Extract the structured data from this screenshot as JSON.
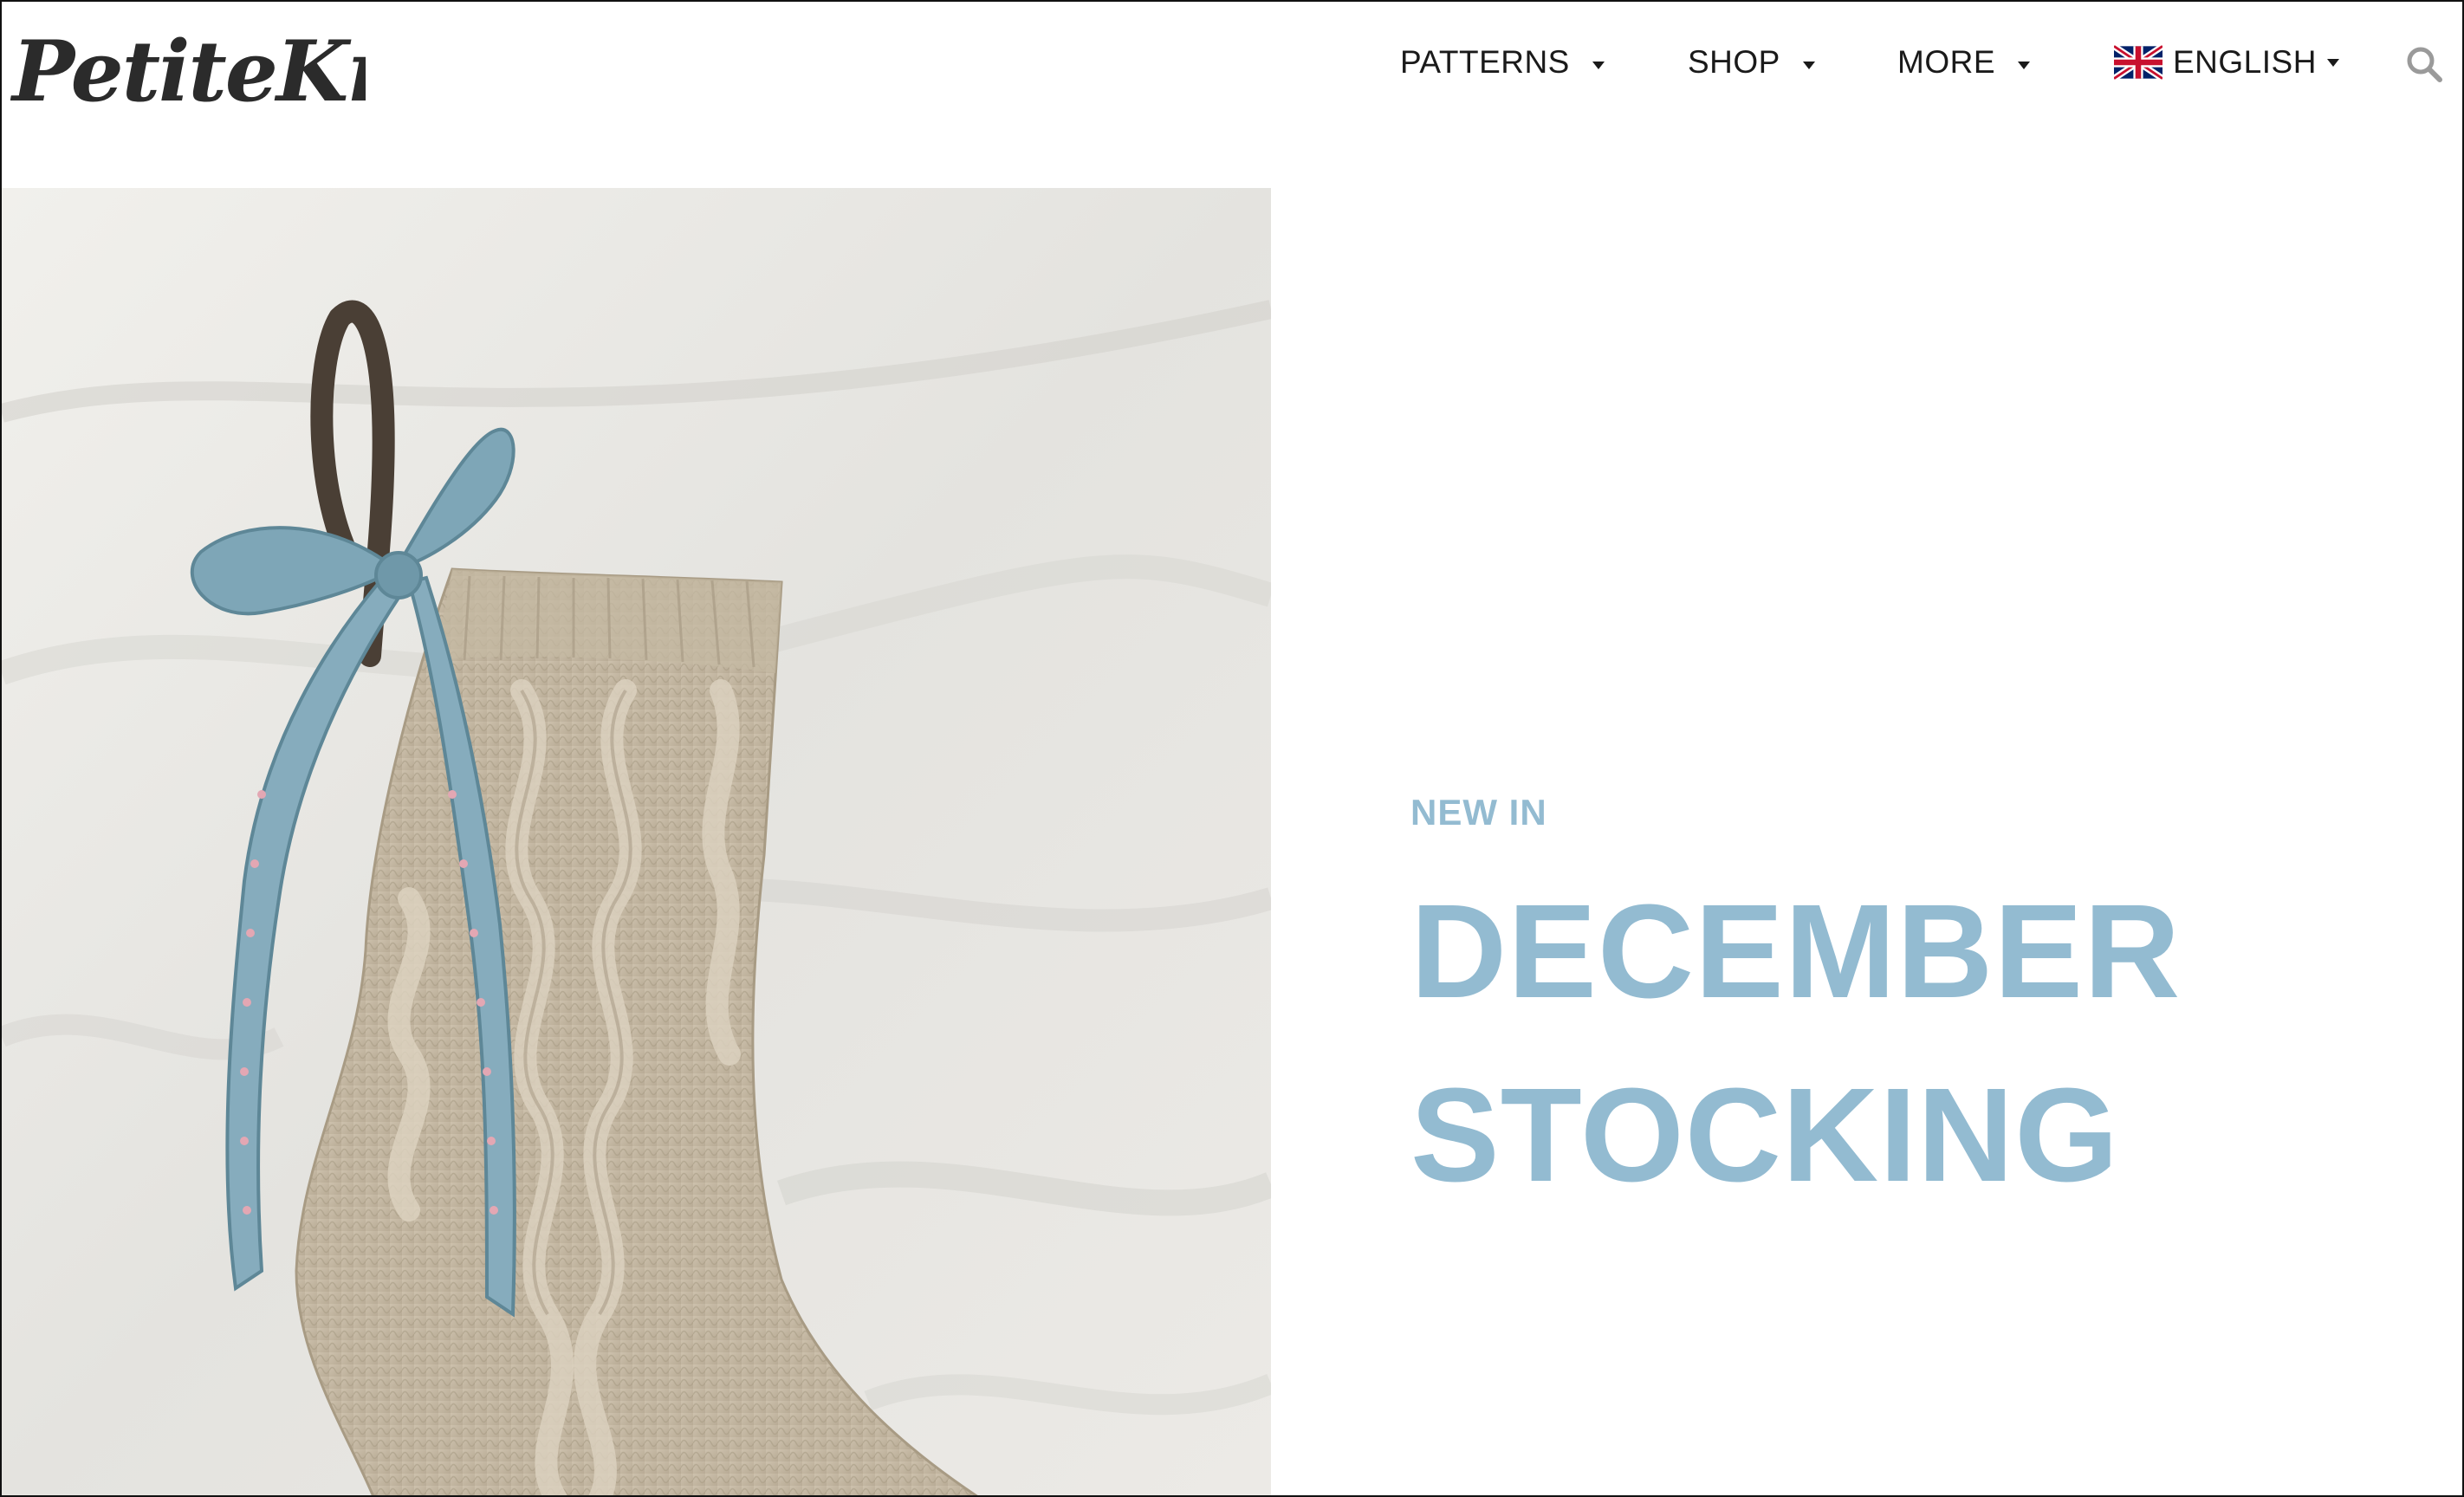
{
  "header": {
    "logo_text": "PetiteKnit",
    "nav": [
      {
        "label": "PATTERNS"
      },
      {
        "label": "SHOP"
      },
      {
        "label": "MORE"
      }
    ],
    "language": {
      "label": "ENGLISH",
      "flag_icon": "uk-flag-icon"
    },
    "search_icon": "search-icon"
  },
  "hero": {
    "image_icon": "knitted-stocking-photo",
    "eyebrow": "NEW IN",
    "title_line1": "DECEMBER",
    "title_line2": "STOCKING"
  },
  "colors": {
    "accent": "#93bbd1",
    "text": "#1a1a1a",
    "background": "#ffffff"
  }
}
